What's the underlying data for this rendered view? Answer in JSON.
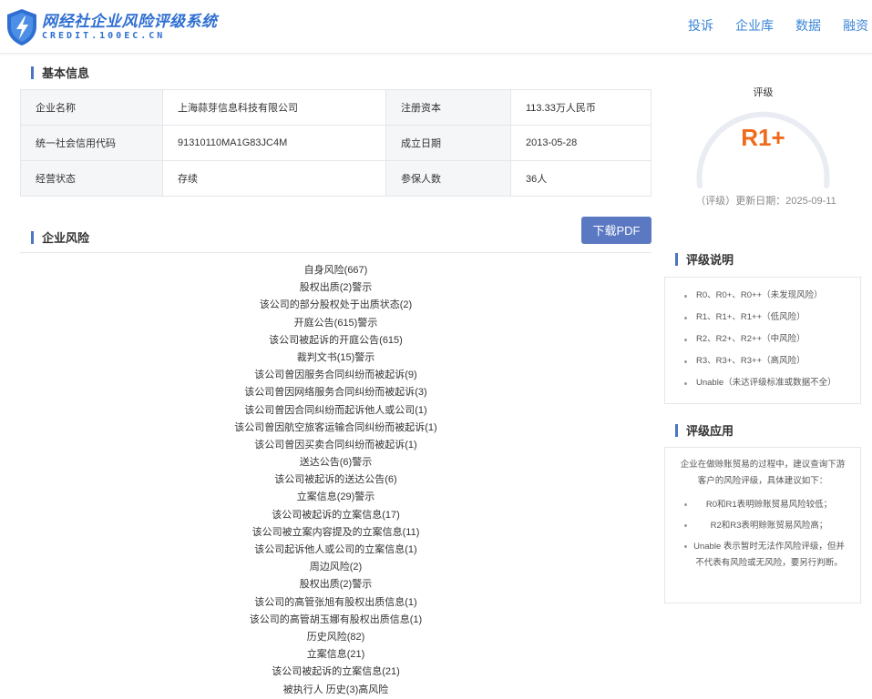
{
  "header": {
    "logo_cn": "网经社企业风险评级系统",
    "logo_en": "CREDIT.100EC.CN",
    "nav": [
      "投诉",
      "企业库",
      "数据",
      "融资"
    ]
  },
  "basic": {
    "title": "基本信息",
    "rows": [
      [
        "企业名称",
        "上海蒜芽信息科技有限公司",
        "注册资本",
        "113.33万人民币"
      ],
      [
        "统一社会信用代码",
        "91310110MA1G83JC4M",
        "成立日期",
        "2013-05-28"
      ],
      [
        "经营状态",
        "存续",
        "参保人数",
        "36人"
      ]
    ]
  },
  "risk": {
    "title": "企业风险",
    "download_label": "下载PDF",
    "items": [
      "自身风险(667)",
      "股权出质(2)警示",
      "该公司的部分股权处于出质状态(2)",
      "开庭公告(615)警示",
      "该公司被起诉的开庭公告(615)",
      "裁判文书(15)警示",
      "该公司曾因服务合同纠纷而被起诉(9)",
      "该公司曾因网络服务合同纠纷而被起诉(3)",
      "该公司曾因合同纠纷而起诉他人或公司(1)",
      "该公司曾因航空旅客运输合同纠纷而被起诉(1)",
      "该公司曾因买卖合同纠纷而被起诉(1)",
      "送达公告(6)警示",
      "该公司被起诉的送达公告(6)",
      "立案信息(29)警示",
      "该公司被起诉的立案信息(17)",
      "该公司被立案内容提及的立案信息(11)",
      "该公司起诉他人或公司的立案信息(1)",
      "周边风险(2)",
      "股权出质(2)警示",
      "该公司的高管张旭有股权出质信息(1)",
      "该公司的高管胡玉娜有股权出质信息(1)",
      "历史风险(82)",
      "立案信息(21)",
      "该公司被起诉的立案信息(21)",
      "被执行人 历史(3)高风险"
    ]
  },
  "rating": {
    "label": "评级",
    "value": "R1+",
    "date_text": "（评级）更新日期：2025-09-11",
    "accent_color": "#f06a1a",
    "gauge_color": "#e9edf3"
  },
  "legend": {
    "title": "评级说明",
    "items": [
      "R0、R0+、R0++（未发现风险）",
      "R1、R1+、R1++（低风险）",
      "R2、R2+、R2++（中风险）",
      "R3、R3+、R3++（高风险）",
      "Unable（未达评级标准或数据不全）"
    ]
  },
  "application": {
    "title": "评级应用",
    "intro": "企业在做赊账贸易的过程中，建议查询下游客户的风险评级，具体建议如下：",
    "items": [
      "R0和R1表明赊账贸易风险较低；",
      "R2和R3表明赊账贸易风险高；",
      "Unable 表示暂时无法作风险评级，但并不代表有风险或无风险，要另行判断。"
    ]
  }
}
